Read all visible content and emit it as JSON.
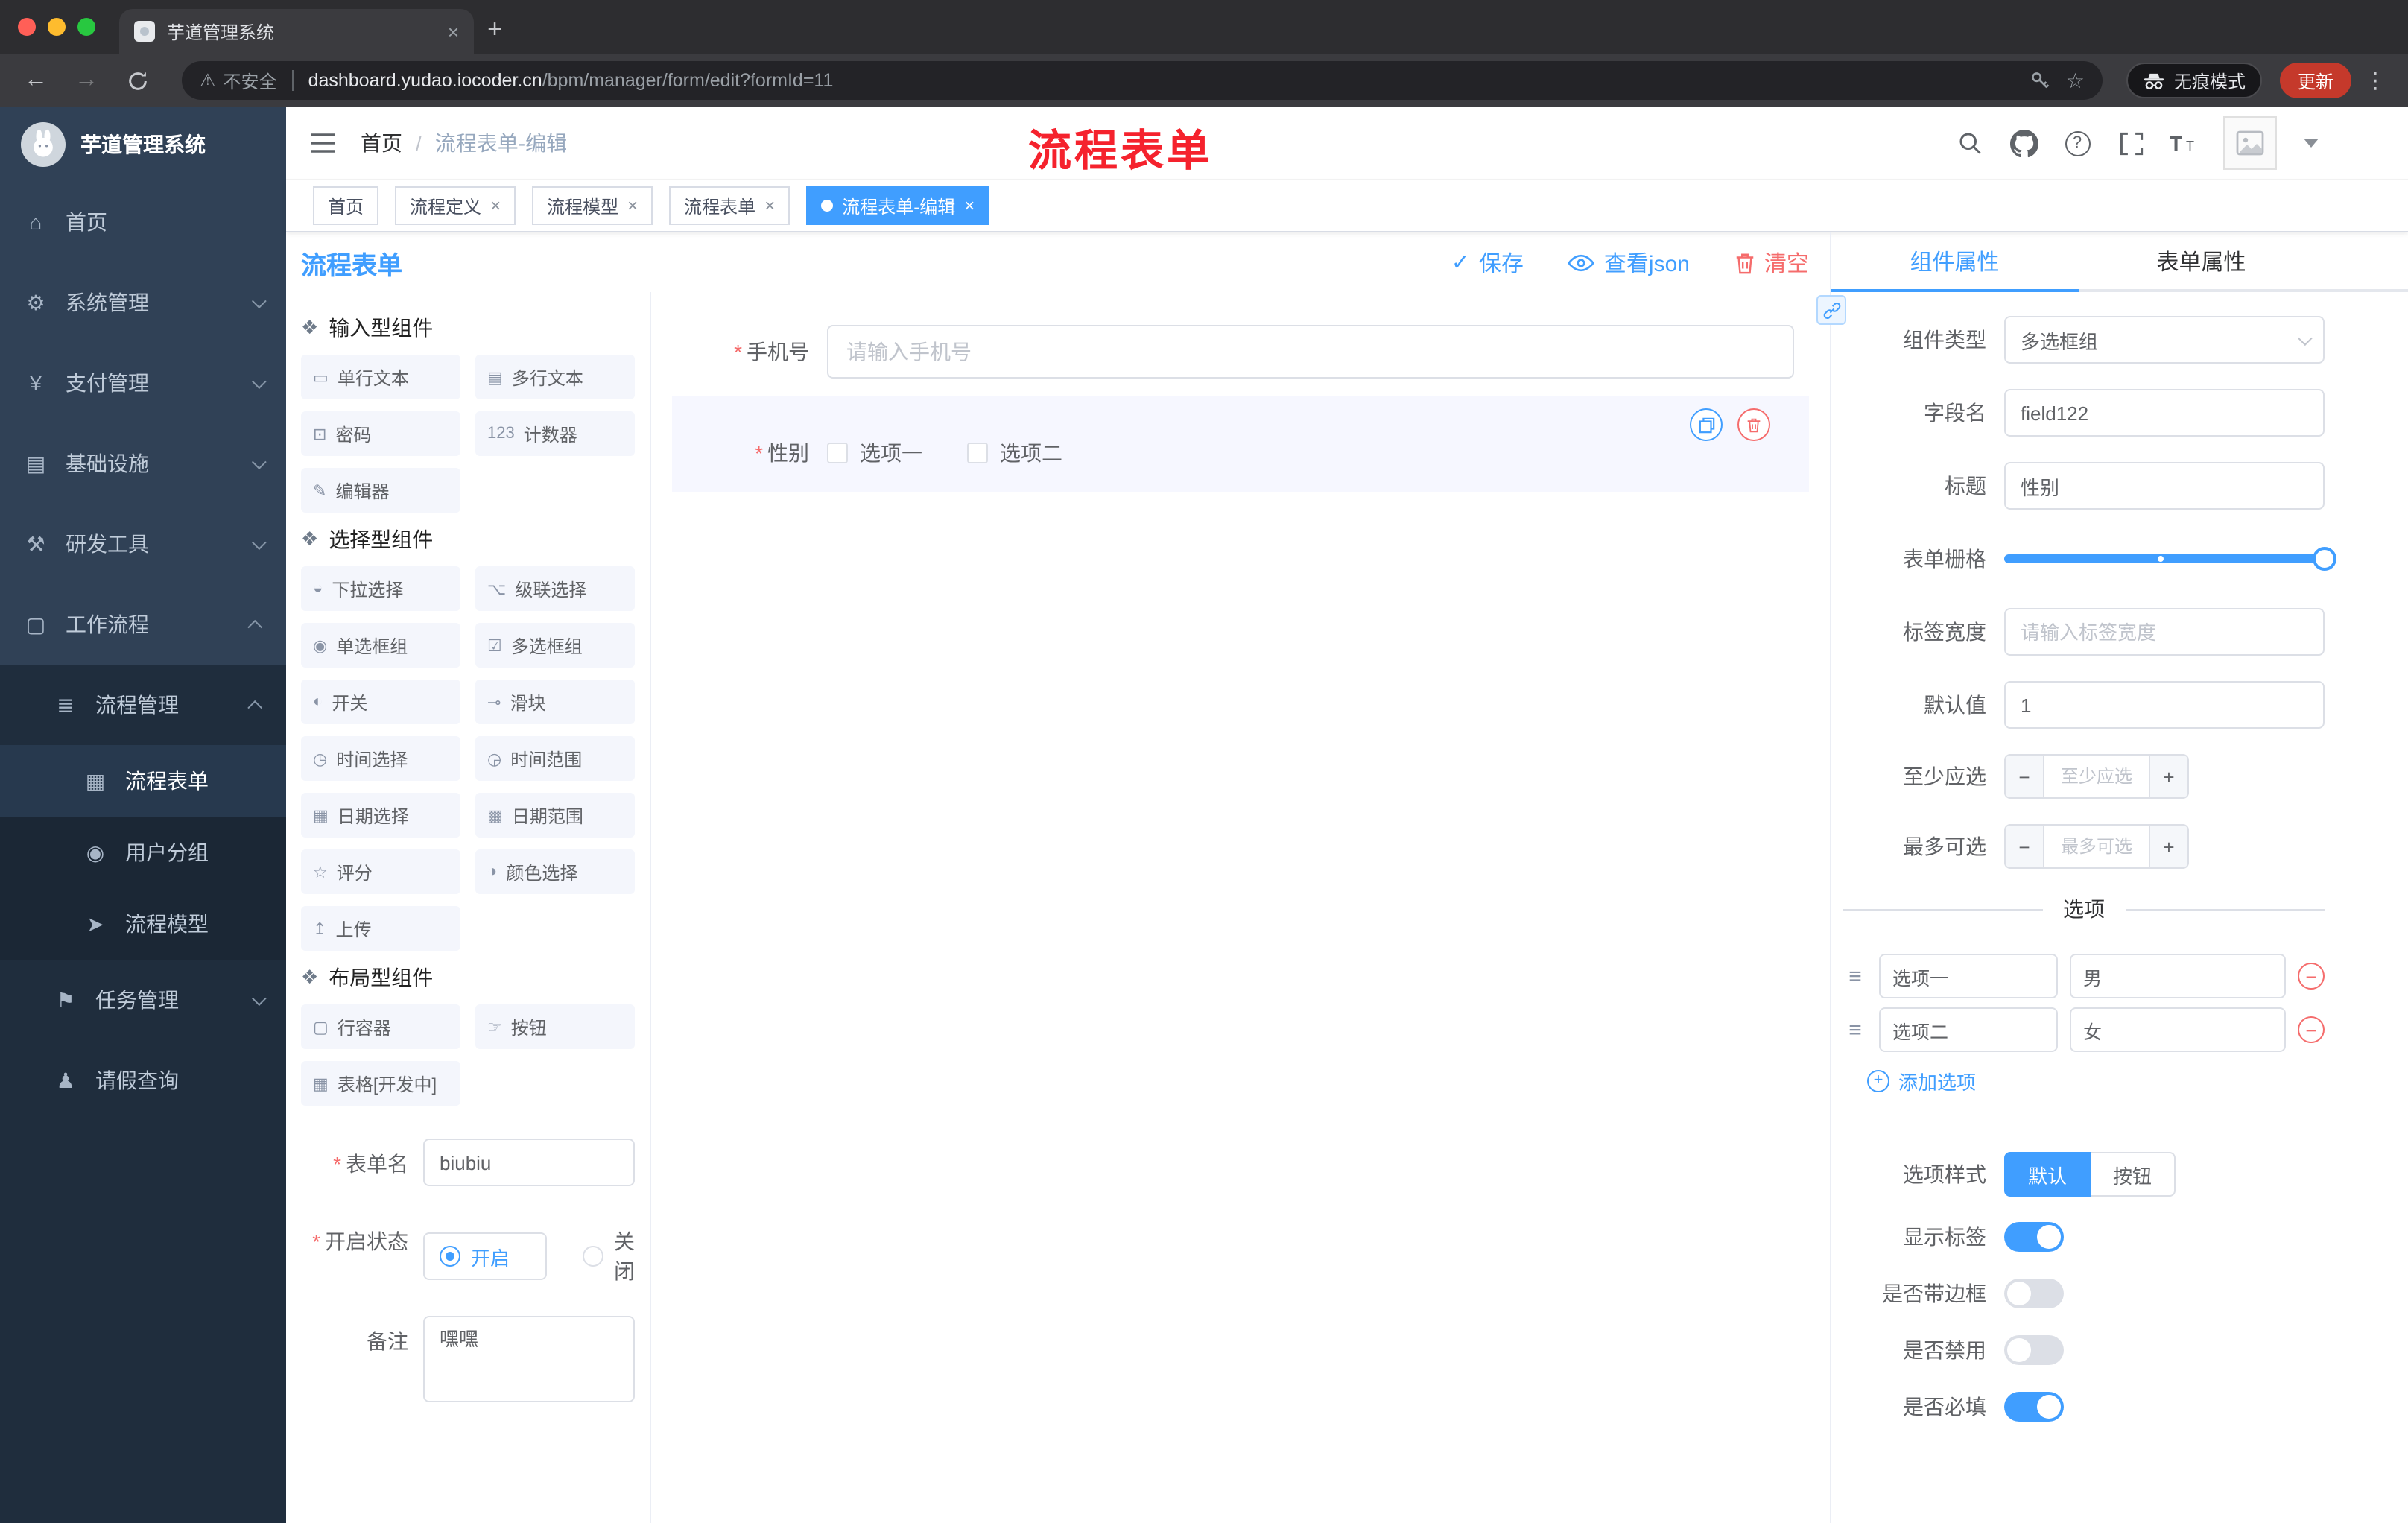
{
  "colors": {
    "accent": "#409EFF",
    "danger": "#F56C6C",
    "sidebar_bg": "#304156",
    "submenu_bg": "#1f2d3d",
    "annotation_red": "#f5222d"
  },
  "ui": {
    "close": "×",
    "plus": "+",
    "minus": "−",
    "question": "?",
    "star": "☆",
    "warning": "⚠",
    "dots": "⋮",
    "back": "←",
    "forward": "→",
    "sep": "/",
    "grip": "≡",
    "check": "✓",
    "new_tab": "+"
  },
  "browser": {
    "tab_title": "芋道管理系统",
    "security_label": "不安全",
    "url_host": "dashboard.yudao.iocoder.cn",
    "url_path": "/bpm/manager/form/edit?formId=11",
    "incognito_label": "无痕模式",
    "update_label": "更新"
  },
  "sidebar": {
    "logo_title": "芋道管理系统",
    "items": [
      {
        "label": "首页",
        "icon": "⌂"
      },
      {
        "label": "系统管理",
        "icon": "⚙"
      },
      {
        "label": "支付管理",
        "icon": "¥"
      },
      {
        "label": "基础设施",
        "icon": "▤"
      },
      {
        "label": "研发工具",
        "icon": "⚒"
      },
      {
        "label": "工作流程",
        "icon": "▢"
      }
    ],
    "submenu": {
      "label": "流程管理",
      "icon": "≣",
      "children": [
        {
          "label": "流程表单",
          "icon": "▦",
          "active": true
        },
        {
          "label": "用户分组",
          "icon": "◉"
        },
        {
          "label": "流程模型",
          "icon": "➤"
        }
      ]
    },
    "task": {
      "label": "任务管理",
      "icon": "⚑"
    },
    "leave": {
      "label": "请假查询",
      "icon": "♟"
    }
  },
  "header": {
    "breadcrumb_home": "首页",
    "breadcrumb_current": "流程表单-编辑",
    "annotation": "流程表单"
  },
  "tags": {
    "items": [
      {
        "label": "首页",
        "closable": false,
        "active": false
      },
      {
        "label": "流程定义",
        "closable": true,
        "active": false
      },
      {
        "label": "流程模型",
        "closable": true,
        "active": false
      },
      {
        "label": "流程表单",
        "closable": true,
        "active": false
      },
      {
        "label": "流程表单-编辑",
        "closable": true,
        "active": true
      }
    ]
  },
  "designer": {
    "title": "流程表单",
    "save": "保存",
    "view_json": "查看json",
    "clear": "清空"
  },
  "palette": {
    "sections": [
      {
        "title": "输入型组件",
        "icon": "❖",
        "items": [
          {
            "label": "单行文本",
            "icon": "▭"
          },
          {
            "label": "多行文本",
            "icon": "▤"
          },
          {
            "label": "密码",
            "icon": "⊡"
          },
          {
            "label": "计数器",
            "icon": "123"
          },
          {
            "label": "编辑器",
            "icon": "✎"
          }
        ]
      },
      {
        "title": "选择型组件",
        "icon": "❖",
        "items": [
          {
            "label": "下拉选择",
            "icon": "◒"
          },
          {
            "label": "级联选择",
            "icon": "⌥"
          },
          {
            "label": "单选框组",
            "icon": "◉"
          },
          {
            "label": "多选框组",
            "icon": "☑"
          },
          {
            "label": "开关",
            "icon": "◐"
          },
          {
            "label": "滑块",
            "icon": "⊸"
          },
          {
            "label": "时间选择",
            "icon": "◷"
          },
          {
            "label": "时间范围",
            "icon": "◶"
          },
          {
            "label": "日期选择",
            "icon": "▦"
          },
          {
            "label": "日期范围",
            "icon": "▩"
          },
          {
            "label": "评分",
            "icon": "☆"
          },
          {
            "label": "颜色选择",
            "icon": "◑"
          },
          {
            "label": "上传",
            "icon": "↥"
          }
        ]
      },
      {
        "title": "布局型组件",
        "icon": "❖",
        "items": [
          {
            "label": "行容器",
            "icon": "▢"
          },
          {
            "label": "按钮",
            "icon": "☞"
          },
          {
            "label": "表格[开发中]",
            "icon": "▦"
          }
        ]
      }
    ]
  },
  "meta": {
    "form_name": {
      "label": "表单名",
      "value": "biubiu"
    },
    "status": {
      "label": "开启状态",
      "on": "开启",
      "off": "关闭",
      "selected": "开启"
    },
    "remark": {
      "label": "备注",
      "value": "嘿嘿"
    }
  },
  "canvas": {
    "phone_label": "手机号",
    "phone_placeholder": "请输入手机号",
    "gender_label": "性别",
    "gender_options": [
      {
        "label": "选项一"
      },
      {
        "label": "选项二"
      }
    ]
  },
  "props": {
    "tab_component": "组件属性",
    "tab_form": "表单属性",
    "rows": {
      "type": {
        "label": "组件类型",
        "value": "多选框组"
      },
      "field": {
        "label": "字段名",
        "value": "field122"
      },
      "title": {
        "label": "标题",
        "value": "性别"
      },
      "grid": {
        "label": "表单栅格"
      },
      "label_width": {
        "label": "标签宽度",
        "placeholder": "请输入标签宽度"
      },
      "default": {
        "label": "默认值",
        "value": "1"
      },
      "min": {
        "label": "至少应选",
        "placeholder": "至少应选"
      },
      "max": {
        "label": "最多可选",
        "placeholder": "最多可选"
      }
    },
    "options_divider": "选项",
    "options": [
      {
        "name": "选项一",
        "value": "男"
      },
      {
        "name": "选项二",
        "value": "女"
      }
    ],
    "add_option": "添加选项",
    "style": {
      "label": "选项样式",
      "default": "默认",
      "button": "按钮",
      "selected": "默认"
    },
    "switch_rows": [
      {
        "label": "显示标签",
        "on": true
      },
      {
        "label": "是否带边框",
        "on": false
      },
      {
        "label": "是否禁用",
        "on": false
      },
      {
        "label": "是否必填",
        "on": true
      }
    ]
  }
}
